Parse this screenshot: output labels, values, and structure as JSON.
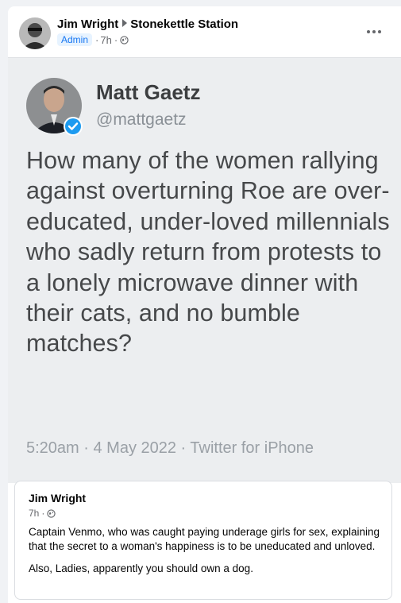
{
  "post": {
    "author": "Jim Wright",
    "group": "Stonekettle Station",
    "role_badge": "Admin",
    "time": "7h",
    "separator": "·",
    "visibility_icon": "globe-icon",
    "menu_icon": "more-options-icon"
  },
  "tweet": {
    "display_name": "Matt Gaetz",
    "handle": "@mattgaetz",
    "text": "How many of the women rallying against overturning Roe are over-educated, under-loved millennials who sadly return from protests to a lonely microwave dinner with their cats, and no bumble matches?",
    "meta": "5:20am · 4 May 2022 · Twitter for iPhone",
    "verified_icon": "verified-badge-icon"
  },
  "shared_post": {
    "author": "Jim Wright",
    "time": "7h",
    "separator": "·",
    "paragraph1": "Captain Venmo, who was caught paying underage girls for sex, explaining that the secret to a woman's happiness is to be uneducated and unloved.",
    "paragraph2": "Also, Ladies, apparently you should own a dog."
  },
  "colors": {
    "accent": "#1877f2",
    "verified": "#1d9bf0",
    "muted": "#65676b"
  }
}
